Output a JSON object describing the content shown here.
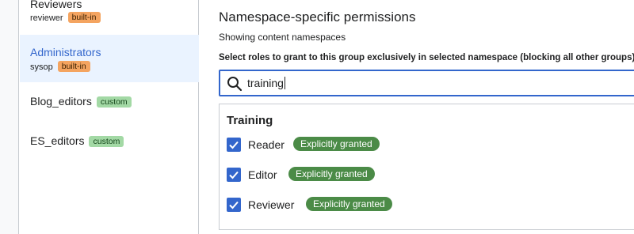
{
  "sidebar": {
    "groups": [
      {
        "name": "Reviewers",
        "sub": "reviewer",
        "tag": "built-in"
      },
      {
        "name": "Administrators",
        "sub": "sysop",
        "tag": "built-in"
      },
      {
        "name": "Blog_editors",
        "tag": "custom"
      },
      {
        "name": "ES_editors",
        "tag": "custom"
      }
    ]
  },
  "main": {
    "title": "Namespace-specific permissions",
    "subtitle": "Showing content namespaces",
    "instruction": "Select roles to grant to this group exclusively in selected namespace (blocking all other groups)",
    "search": {
      "value": "training",
      "icon": "search-icon"
    },
    "namespace": {
      "title": "Training",
      "permissions": [
        {
          "label": "Reader",
          "checked": true,
          "badge": "Explicitly granted"
        },
        {
          "label": "Editor",
          "checked": true,
          "badge": "Explicitly granted"
        },
        {
          "label": "Reviewer",
          "checked": true,
          "badge": "Explicitly granted"
        }
      ]
    }
  },
  "colors": {
    "accent": "#3366cc",
    "active_bg": "#eaf3ff",
    "builtin_tag": "#f4a460",
    "custom_tag": "#a3d9a5",
    "granted_badge": "#4b8b47"
  }
}
